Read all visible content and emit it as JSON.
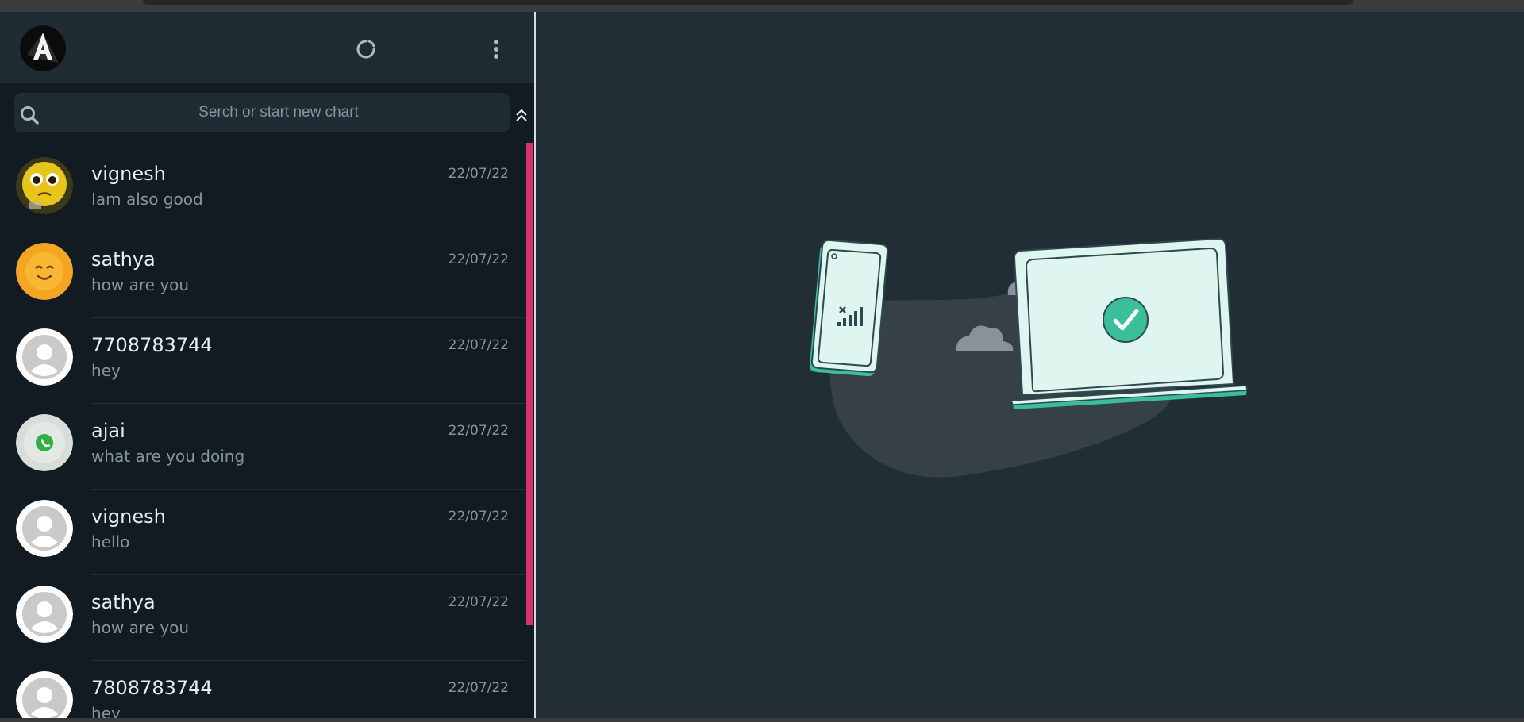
{
  "search": {
    "placeholder": "Serch or start new chart"
  },
  "chats": [
    {
      "name": "vignesh",
      "message": "Iam also good",
      "time": "22/07/22",
      "avatar": "emoji-pleading-avatar"
    },
    {
      "name": "sathya",
      "message": "how are you",
      "time": "22/07/22",
      "avatar": "emoji-smile-avatar"
    },
    {
      "name": "7708783744",
      "message": "hey",
      "time": "22/07/22",
      "avatar": "default-user-avatar"
    },
    {
      "name": "ajai",
      "message": "what are you doing",
      "time": "22/07/22",
      "avatar": "whatsapp-logo-avatar"
    },
    {
      "name": "vignesh",
      "message": "hello",
      "time": "22/07/22",
      "avatar": "default-user-avatar"
    },
    {
      "name": "sathya",
      "message": "how are you",
      "time": "22/07/22",
      "avatar": "default-user-avatar"
    },
    {
      "name": "7808783744",
      "message": "hey",
      "time": "22/07/22",
      "avatar": "default-user-avatar"
    }
  ],
  "icons": {
    "logo": "angular-logo-icon",
    "status": "refresh-icon",
    "menu": "vertical-dots-menu-icon",
    "search": "search-icon",
    "collapse": "chevron-double-up-icon"
  },
  "colors": {
    "accent": "#d7336b",
    "header": "#202c33",
    "sidebar": "#111b21",
    "main": "#222e35",
    "teal": "#3bbf9a"
  }
}
